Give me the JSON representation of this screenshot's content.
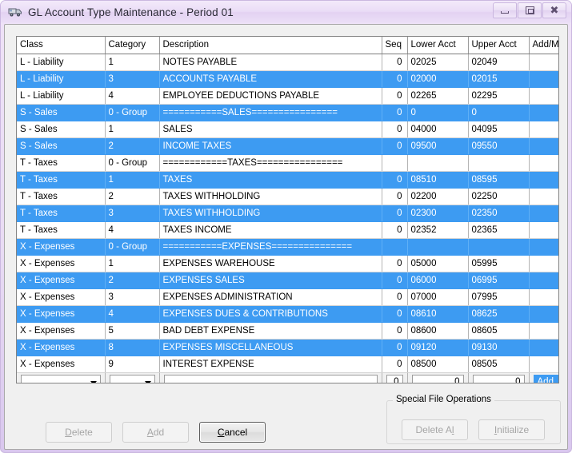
{
  "window": {
    "title": "GL Account Type Maintenance - Period 01",
    "icon": "truck-icon",
    "accent_titlebar": "#e9dcf4",
    "accent_selection": "#3d9bf2",
    "controls": {
      "minimize": "minimize-icon",
      "maximize": "maximize-icon",
      "close": "close-icon"
    }
  },
  "grid": {
    "columns": [
      {
        "key": "class",
        "label": "Class"
      },
      {
        "key": "category",
        "label": "Category"
      },
      {
        "key": "description",
        "label": "Description"
      },
      {
        "key": "seq",
        "label": "Seq"
      },
      {
        "key": "lower",
        "label": "Lower Acct"
      },
      {
        "key": "upper",
        "label": "Upper Acct"
      },
      {
        "key": "addmod",
        "label": "Add/Mod"
      }
    ],
    "rows": [
      {
        "class": "L - Liability",
        "category": "1",
        "description": "NOTES PAYABLE",
        "seq": "0",
        "lower": "02025",
        "upper": "02049",
        "addmod": "",
        "selected": false
      },
      {
        "class": "L - Liability",
        "category": "3",
        "description": "ACCOUNTS PAYABLE",
        "seq": "0",
        "lower": "02000",
        "upper": "02015",
        "addmod": "",
        "selected": true
      },
      {
        "class": "L - Liability",
        "category": "4",
        "description": "EMPLOYEE DEDUCTIONS PAYABLE",
        "seq": "0",
        "lower": "02265",
        "upper": "02295",
        "addmod": "",
        "selected": false
      },
      {
        "class": "S - Sales",
        "category": "0 - Group",
        "description": "===========SALES================",
        "seq": "0",
        "lower": "0",
        "upper": "0",
        "addmod": "",
        "selected": true
      },
      {
        "class": "S - Sales",
        "category": "1",
        "description": "SALES",
        "seq": "0",
        "lower": "04000",
        "upper": "04095",
        "addmod": "",
        "selected": false
      },
      {
        "class": "S - Sales",
        "category": "2",
        "description": "INCOME TAXES",
        "seq": "0",
        "lower": "09500",
        "upper": "09550",
        "addmod": "",
        "selected": true
      },
      {
        "class": "T - Taxes",
        "category": "0 - Group",
        "description": "============TAXES================",
        "seq": "",
        "lower": "",
        "upper": "",
        "addmod": "",
        "selected": false
      },
      {
        "class": "T - Taxes",
        "category": "1",
        "description": "TAXES",
        "seq": "0",
        "lower": "08510",
        "upper": "08595",
        "addmod": "",
        "selected": true
      },
      {
        "class": "T - Taxes",
        "category": "2",
        "description": "TAXES WITHHOLDING",
        "seq": "0",
        "lower": "02200",
        "upper": "02250",
        "addmod": "",
        "selected": false
      },
      {
        "class": "T - Taxes",
        "category": "3",
        "description": "TAXES WITHHOLDING",
        "seq": "0",
        "lower": "02300",
        "upper": "02350",
        "addmod": "",
        "selected": true
      },
      {
        "class": "T - Taxes",
        "category": "4",
        "description": "TAXES INCOME",
        "seq": "0",
        "lower": "02352",
        "upper": "02365",
        "addmod": "",
        "selected": false
      },
      {
        "class": "X - Expenses",
        "category": "0 - Group",
        "description": "===========EXPENSES===============",
        "seq": "",
        "lower": "",
        "upper": "",
        "addmod": "",
        "selected": true
      },
      {
        "class": "X - Expenses",
        "category": "1",
        "description": "EXPENSES WAREHOUSE",
        "seq": "0",
        "lower": "05000",
        "upper": "05995",
        "addmod": "",
        "selected": false
      },
      {
        "class": "X - Expenses",
        "category": "2",
        "description": "EXPENSES SALES",
        "seq": "0",
        "lower": "06000",
        "upper": "06995",
        "addmod": "",
        "selected": true
      },
      {
        "class": "X - Expenses",
        "category": "3",
        "description": "EXPENSES ADMINISTRATION",
        "seq": "0",
        "lower": "07000",
        "upper": "07995",
        "addmod": "",
        "selected": false
      },
      {
        "class": "X - Expenses",
        "category": "4",
        "description": "EXPENSES DUES & CONTRIBUTIONS",
        "seq": "0",
        "lower": "08610",
        "upper": "08625",
        "addmod": "",
        "selected": true
      },
      {
        "class": "X - Expenses",
        "category": "5",
        "description": "BAD DEBT EXPENSE",
        "seq": "0",
        "lower": "08600",
        "upper": "08605",
        "addmod": "",
        "selected": false
      },
      {
        "class": "X - Expenses",
        "category": "8",
        "description": "EXPENSES MISCELLANEOUS",
        "seq": "0",
        "lower": "09120",
        "upper": "09130",
        "addmod": "",
        "selected": true
      },
      {
        "class": "X - Expenses",
        "category": "9",
        "description": "INTEREST EXPENSE",
        "seq": "0",
        "lower": "08500",
        "upper": "08505",
        "addmod": "",
        "selected": false
      }
    ],
    "new_row": {
      "class_value": "",
      "category_value": "",
      "description_value": "",
      "seq": "0",
      "lower": "0",
      "upper": "0",
      "addmod": "Add"
    },
    "scrollbar": {
      "up_icon": "scroll-up-arrow-icon",
      "down_icon": "scroll-down-arrow-icon"
    }
  },
  "actions": {
    "delete_label": "Delete",
    "delete_accel": "D",
    "add_label": "Add",
    "add_accel": "A",
    "cancel_label": "Cancel",
    "cancel_accel": "C"
  },
  "special_operations": {
    "legend": "Special File Operations",
    "delete_all_label": "Delete All",
    "delete_all_accel": "l",
    "initialize_label": "Initialize",
    "initialize_accel": "I"
  }
}
